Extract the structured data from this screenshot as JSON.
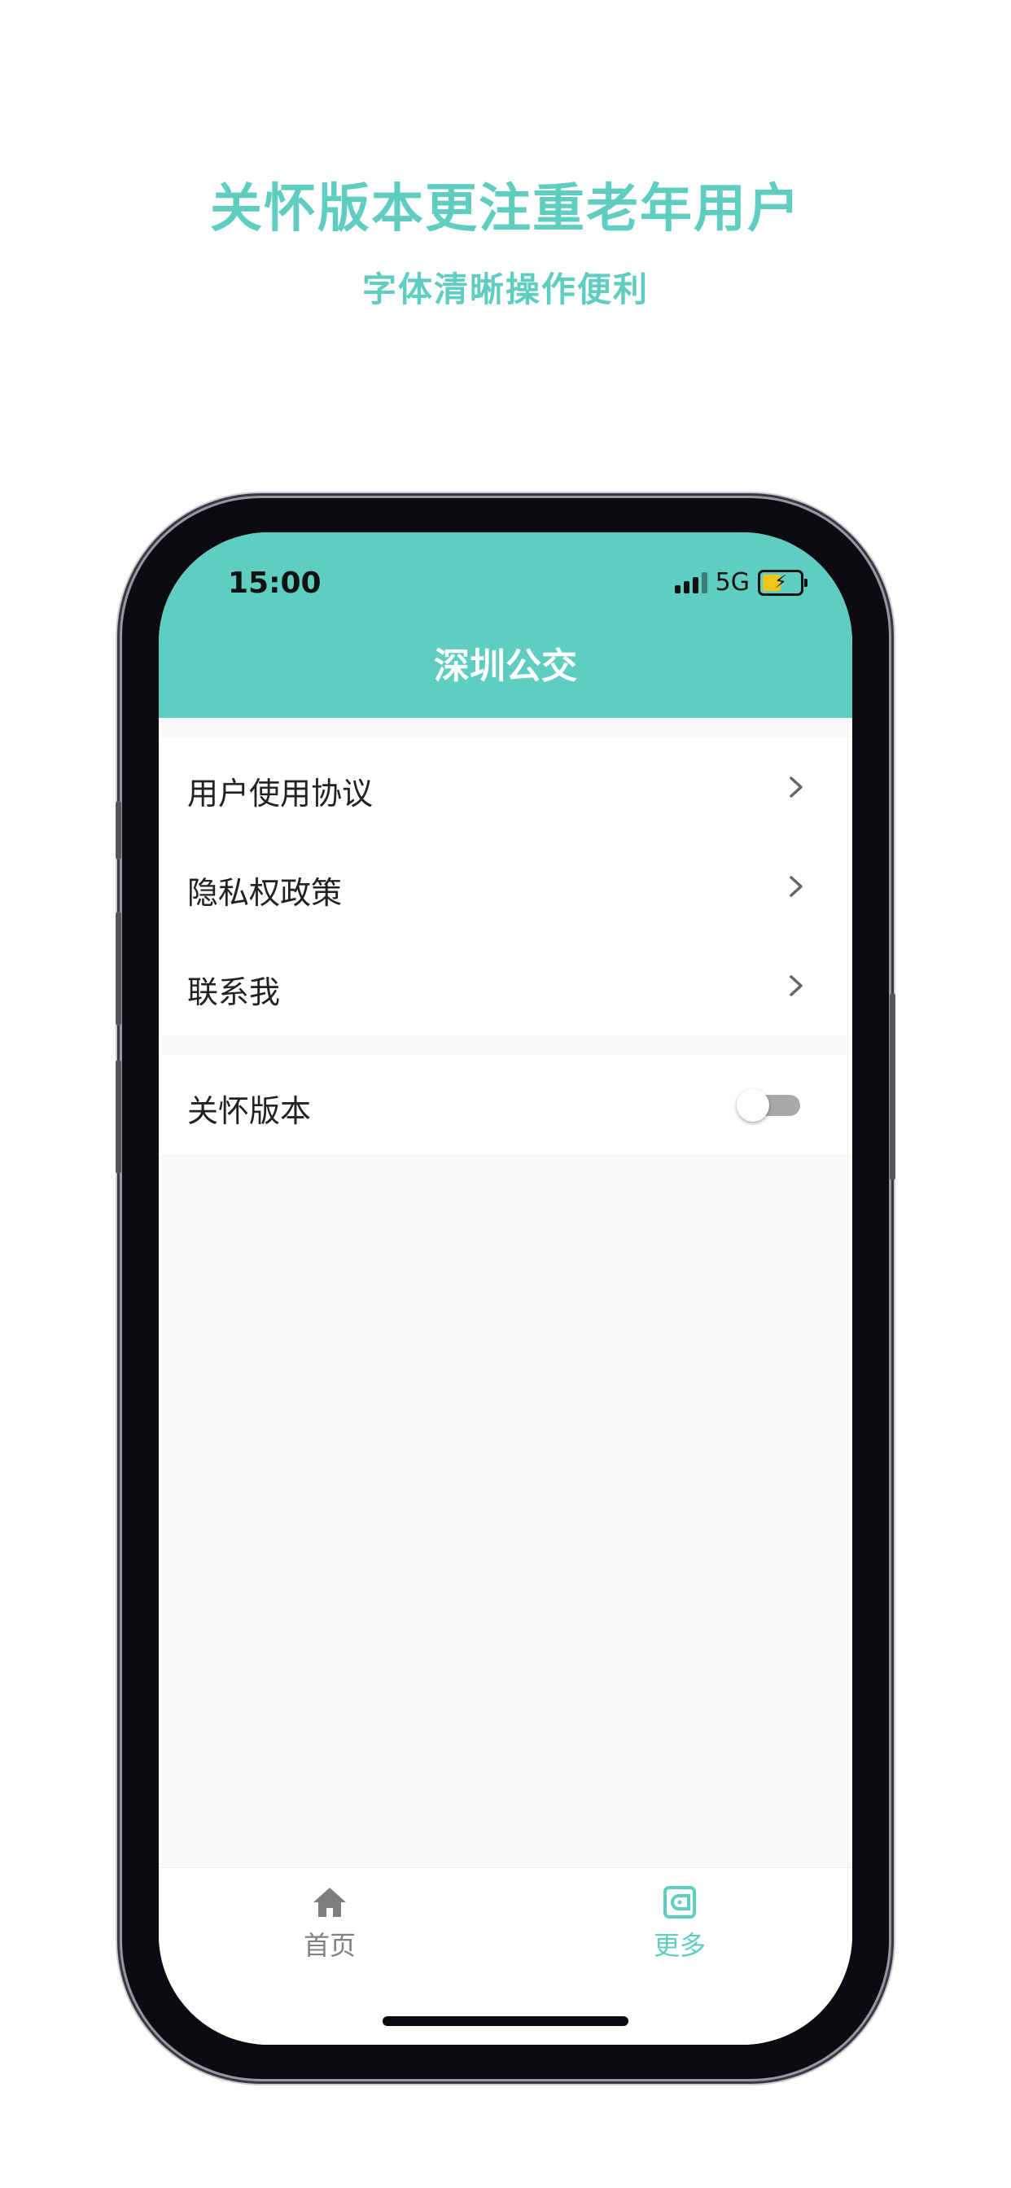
{
  "promo": {
    "headline": "关怀版本更注重老年用户",
    "subheadline": "字体清晰操作便利"
  },
  "status_bar": {
    "time": "15:00",
    "network": "5G",
    "icons": [
      "signal-icon",
      "battery-charging-icon"
    ]
  },
  "header": {
    "title": "深圳公交"
  },
  "menu": {
    "items": [
      {
        "label": "用户使用协议",
        "icon": "chevron-right-icon"
      },
      {
        "label": "隐私权政策",
        "icon": "chevron-right-icon"
      },
      {
        "label": "联系我",
        "icon": "chevron-right-icon"
      }
    ],
    "care_mode": {
      "label": "关怀版本",
      "toggle_on": false
    }
  },
  "tabbar": {
    "tabs": [
      {
        "label": "首页",
        "icon": "home-icon",
        "active": false
      },
      {
        "label": "更多",
        "icon": "wallet-icon",
        "active": true
      }
    ],
    "active_color": "#5fcdbf",
    "inactive_color": "#808080"
  },
  "colors": {
    "accent": "#5fcdbf"
  }
}
